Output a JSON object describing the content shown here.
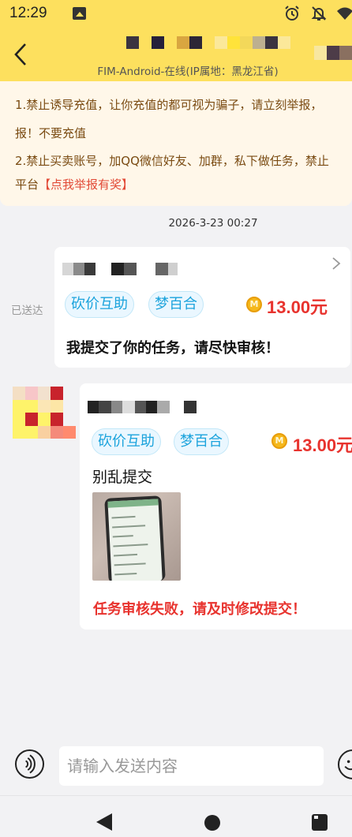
{
  "status_bar": {
    "time": "12:29",
    "icons": [
      "gallery-icon",
      "alarm-icon",
      "notifications-off-icon",
      "wifi-icon"
    ]
  },
  "header": {
    "subtitle": "FIM-Android-在线(IP属地：黑龙江省)",
    "back_icon": "chevron-left-icon"
  },
  "notice": {
    "line1": "1.禁止诱导充值，让你充值的都可视为骗子，请立刻举报，",
    "line2": "报！不要充值",
    "line3": "2.禁止买卖账号，加QQ微信好友、加群，私下做任务，禁止",
    "line4_prefix": "平台",
    "line4_link": "【点我举报有奖】"
  },
  "chat": {
    "timestamp": "2026-3-23 00:27",
    "messages": [
      {
        "direction": "sent",
        "status": "已送达",
        "tags": [
          "砍价互助",
          "梦百合"
        ],
        "coin_symbol": "M",
        "price": "13.00元",
        "text": "我提交了你的任务，请尽快审核！"
      },
      {
        "direction": "received",
        "tags": [
          "砍价互助",
          "梦百合"
        ],
        "coin_symbol": "M",
        "price": "13.00元",
        "comment": "别乱提交",
        "status_text": "任务审核失败，请及时修改提交！"
      }
    ]
  },
  "input_bar": {
    "placeholder": "请输入发送内容",
    "value": ""
  },
  "colors": {
    "header_bg": "#fde05e",
    "notice_bg": "#fff7e9",
    "notice_text": "#7a4b12",
    "link_red": "#e24b38",
    "price_red": "#e8332e",
    "tag_blue": "#1ba3dc",
    "page_bg": "#f2f2f4"
  }
}
